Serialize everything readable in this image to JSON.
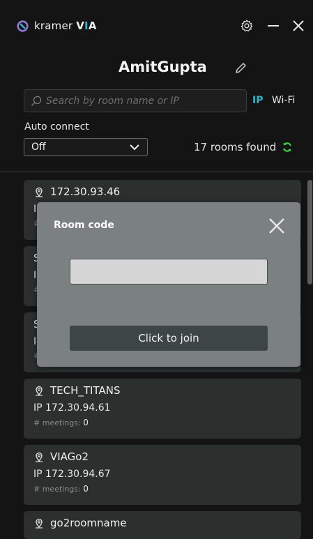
{
  "app": {
    "brand_prefix": "kramer",
    "brand_v": "V",
    "brand_i": "I",
    "brand_a": "A"
  },
  "header": {
    "username": "AmitGupta"
  },
  "search": {
    "placeholder": "Search by room name or IP",
    "value": ""
  },
  "tabs": {
    "ip": "IP",
    "wifi": "Wi-Fi"
  },
  "auto_connect": {
    "label": "Auto connect",
    "value": "Off"
  },
  "rooms_found": "17 rooms found",
  "rooms": [
    {
      "name": "172.30.93.46",
      "ip_prefix": "I",
      "meetings_label": "#",
      "meetings": ""
    },
    {
      "name": "S",
      "ip_prefix": "I",
      "meetings_label": "#",
      "meetings": ""
    },
    {
      "name": "S",
      "ip_prefix": "I",
      "meetings_label": "#",
      "meetings": ""
    },
    {
      "name": "TECH_TITANS",
      "ip": "IP 172.30.94.61",
      "meetings_label": "# meetings:",
      "meetings": "0"
    },
    {
      "name": "VIAGo2",
      "ip": "IP 172.30.94.67",
      "meetings_label": "# meetings:",
      "meetings": "0"
    },
    {
      "name": "go2roomname",
      "ip": "",
      "meetings_label": "",
      "meetings": ""
    }
  ],
  "modal": {
    "title": "Room code",
    "code_value": "",
    "join_label": "Click to join"
  },
  "colors": {
    "accent": "#2bb7c8",
    "background": "#141414",
    "card": "#2b2f2e",
    "modal": "#7b8181"
  }
}
